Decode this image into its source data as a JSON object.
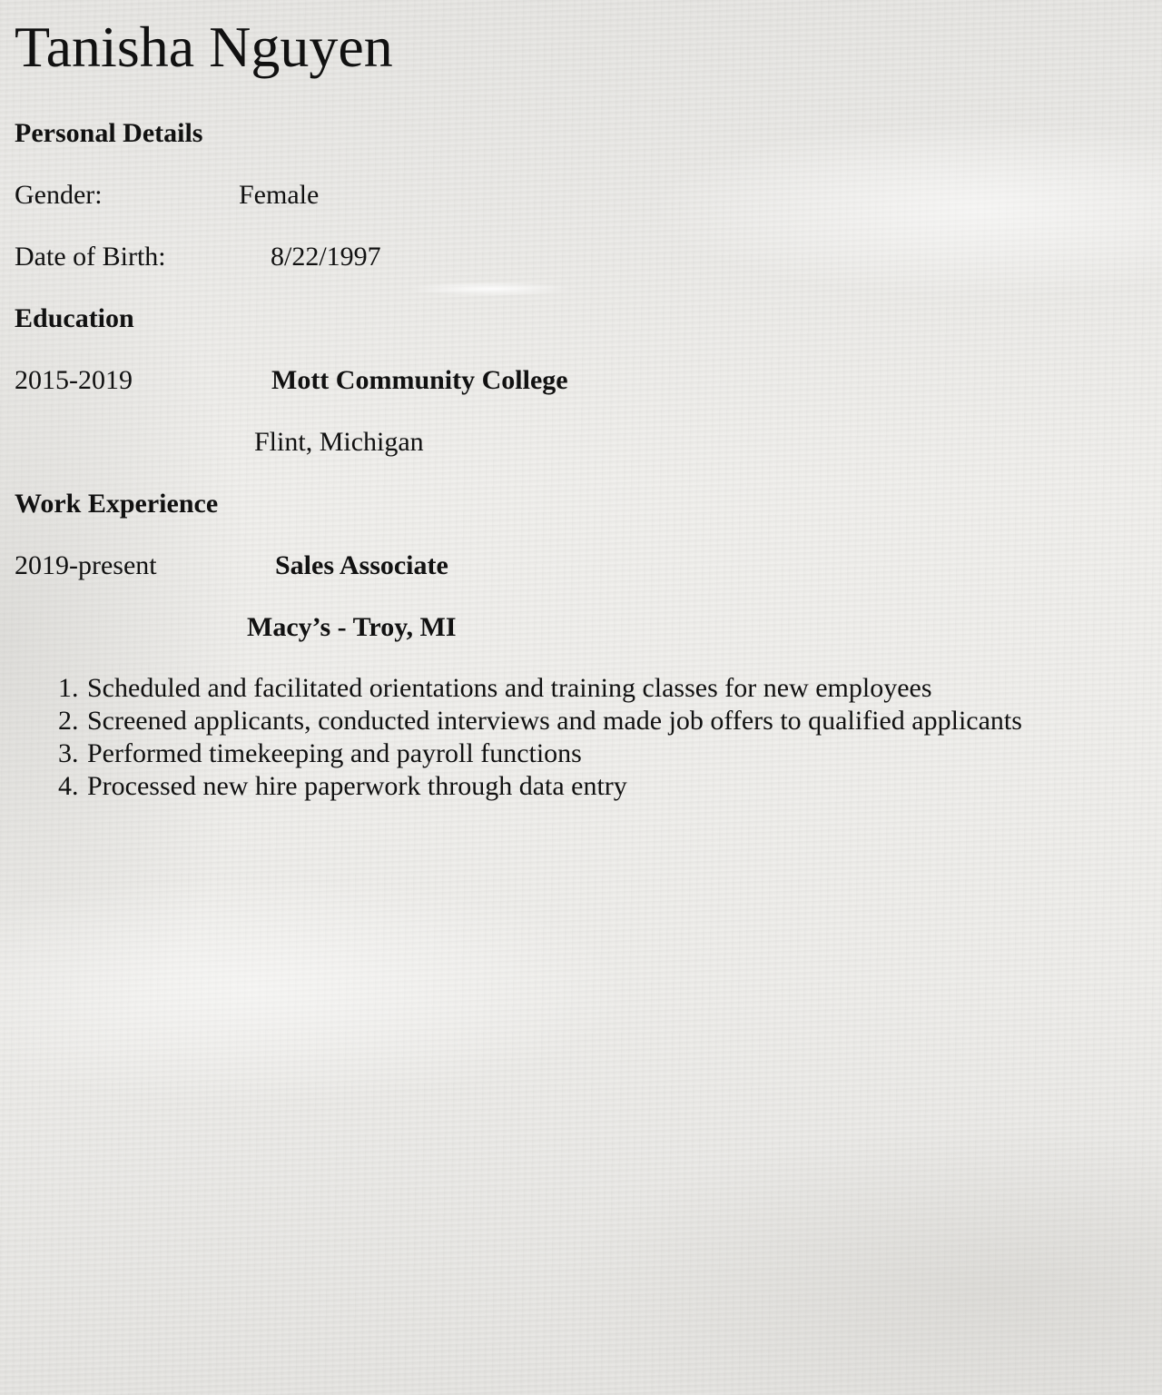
{
  "name": "Tanisha Nguyen",
  "personal": {
    "heading": "Personal Details",
    "gender_label": "Gender:",
    "gender_value": "Female",
    "dob_label": "Date of Birth:",
    "dob_value": "8/22/1997"
  },
  "education": {
    "heading": "Education",
    "years": "2015-2019",
    "school": "Mott Community College",
    "location": "Flint, Michigan"
  },
  "work": {
    "heading": "Work Experience",
    "years": "2019-present",
    "title": "Sales Associate",
    "employer": "Macy’s - Troy, MI",
    "duties": [
      {
        "num": "1.",
        "text": "Scheduled and facilitated orientations and training classes for new employees"
      },
      {
        "num": "2.",
        "text": "Screened applicants, conducted interviews and made job offers to qualified applicants"
      },
      {
        "num": "3.",
        "text": "Performed timekeeping and payroll functions"
      },
      {
        "num": "4.",
        "text": "Processed new hire paperwork through data entry"
      }
    ]
  }
}
